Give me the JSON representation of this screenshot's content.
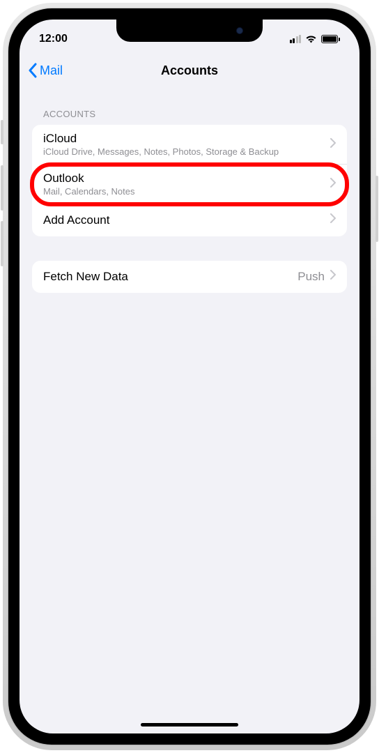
{
  "statusBar": {
    "time": "12:00"
  },
  "nav": {
    "backLabel": "Mail",
    "title": "Accounts"
  },
  "sections": {
    "accounts": {
      "header": "ACCOUNTS",
      "items": [
        {
          "title": "iCloud",
          "subtitle": "iCloud Drive, Messages, Notes, Photos, Storage & Backup"
        },
        {
          "title": "Outlook",
          "subtitle": "Mail, Calendars, Notes"
        },
        {
          "title": "Add Account"
        }
      ]
    },
    "fetch": {
      "title": "Fetch New Data",
      "value": "Push"
    }
  }
}
